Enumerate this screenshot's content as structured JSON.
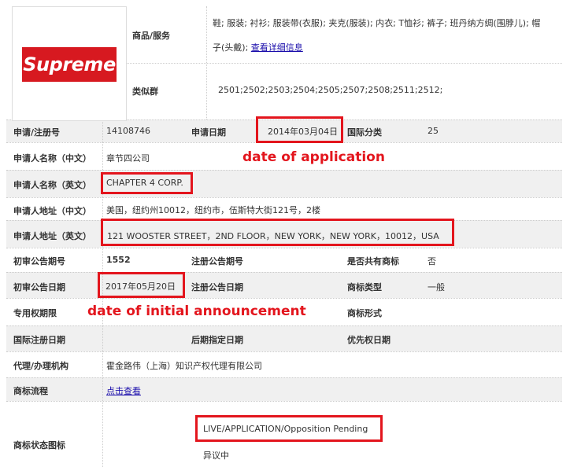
{
  "logo": {
    "text": "Supreme",
    "bg_color": "#d71920"
  },
  "goods": {
    "label": "商品/服务",
    "line1": "鞋; 服装; 衬衫; 服装带(衣服); 夹克(服装); 内衣; T恤衫; 裤子; 班丹纳方绸(围脖儿); 帽",
    "line2": "子(头戴);",
    "link": "查看详细信息"
  },
  "similar_group": {
    "label": "类似群",
    "value": "2501;2502;2503;2504;2505;2507;2508;2511;2512;"
  },
  "reg_no": {
    "label": "申请/注册号",
    "value": "14108746"
  },
  "app_date": {
    "label": "申请日期",
    "value": "2014年03月04日"
  },
  "intl_class": {
    "label": "国际分类",
    "value": "25"
  },
  "applicant_cn": {
    "label": "申请人名称（中文）",
    "value": "章节四公司"
  },
  "applicant_en": {
    "label": "申请人名称（英文）",
    "value": "CHAPTER 4 CORP."
  },
  "address_cn": {
    "label": "申请人地址（中文）",
    "value": "美国，纽约州10012，纽约市，伍斯特大街121号，2楼"
  },
  "address_en": {
    "label": "申请人地址（英文）",
    "value": "121 WOOSTER STREET，2ND FLOOR，NEW YORK，NEW YORK，10012，USA"
  },
  "prelim_no": {
    "label": "初审公告期号",
    "value": "1552"
  },
  "reg_pub_no": {
    "label": "注册公告期号",
    "value": ""
  },
  "shared": {
    "label": "是否共有商标",
    "value": "否"
  },
  "prelim_date": {
    "label": "初审公告日期",
    "value": "2017年05月20日"
  },
  "reg_pub_date": {
    "label": "注册公告日期",
    "value": ""
  },
  "mark_type": {
    "label": "商标类型",
    "value": "一般"
  },
  "exclusive_period": {
    "label": "专用权期限",
    "value": ""
  },
  "mark_form": {
    "label": "商标形式",
    "value": ""
  },
  "intl_reg_date": {
    "label": "国际注册日期",
    "value": ""
  },
  "later_date": {
    "label": "后期指定日期",
    "value": ""
  },
  "priority_date": {
    "label": "优先权日期",
    "value": ""
  },
  "agent": {
    "label": "代理/办理机构",
    "value": "霍金路伟（上海）知识产权代理有限公司"
  },
  "process": {
    "label": "商标流程",
    "link": "点击查看"
  },
  "status": {
    "label": "商标状态图标",
    "value": "LIVE/APPLICATION/Opposition Pending",
    "sub": "异议中"
  },
  "annotations": {
    "app_date": "date of application",
    "prelim_date": "date of initial announcement",
    "color": "#e3151d"
  }
}
